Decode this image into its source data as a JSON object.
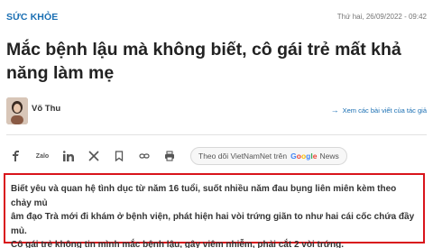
{
  "header": {
    "category": "SỨC KHỎE",
    "datetime": "Thứ hai, 26/09/2022 - 09:42"
  },
  "article": {
    "title": "Mắc bệnh lậu mà không biết, cô gái trẻ mất khả năng làm mẹ",
    "author": "Võ Thu",
    "author_link": "Xem các bài viết của tác giả",
    "summary_line1": "Biết yêu và quan hệ tình dục từ năm 16 tuổi, suốt nhiều năm đau bụng liên miên kèm theo chảy mủ",
    "summary_line2": "âm đạo Trà mới đi khám ở bệnh viện, phát hiện hai vòi trứng giãn to như hai cái cốc chứa đầy mủ.",
    "summary_line3": "Cô gái trẻ không tin mình mắc bệnh lậu, gây viêm nhiễm, phải cắt 2 vòi trứng."
  },
  "share": {
    "icons": [
      "facebook-icon",
      "zalo-icon",
      "linkedin-icon",
      "x-icon",
      "bookmark-icon",
      "link-icon",
      "print-icon"
    ],
    "zalo_label": "Zalo",
    "follow_text": "Theo dõi VietNamNet trên",
    "google": [
      "G",
      "o",
      "o",
      "g",
      "l",
      "e"
    ],
    "news": "News"
  },
  "colors": {
    "brand": "#1a6fb3",
    "highlight_border": "#d9141b"
  }
}
